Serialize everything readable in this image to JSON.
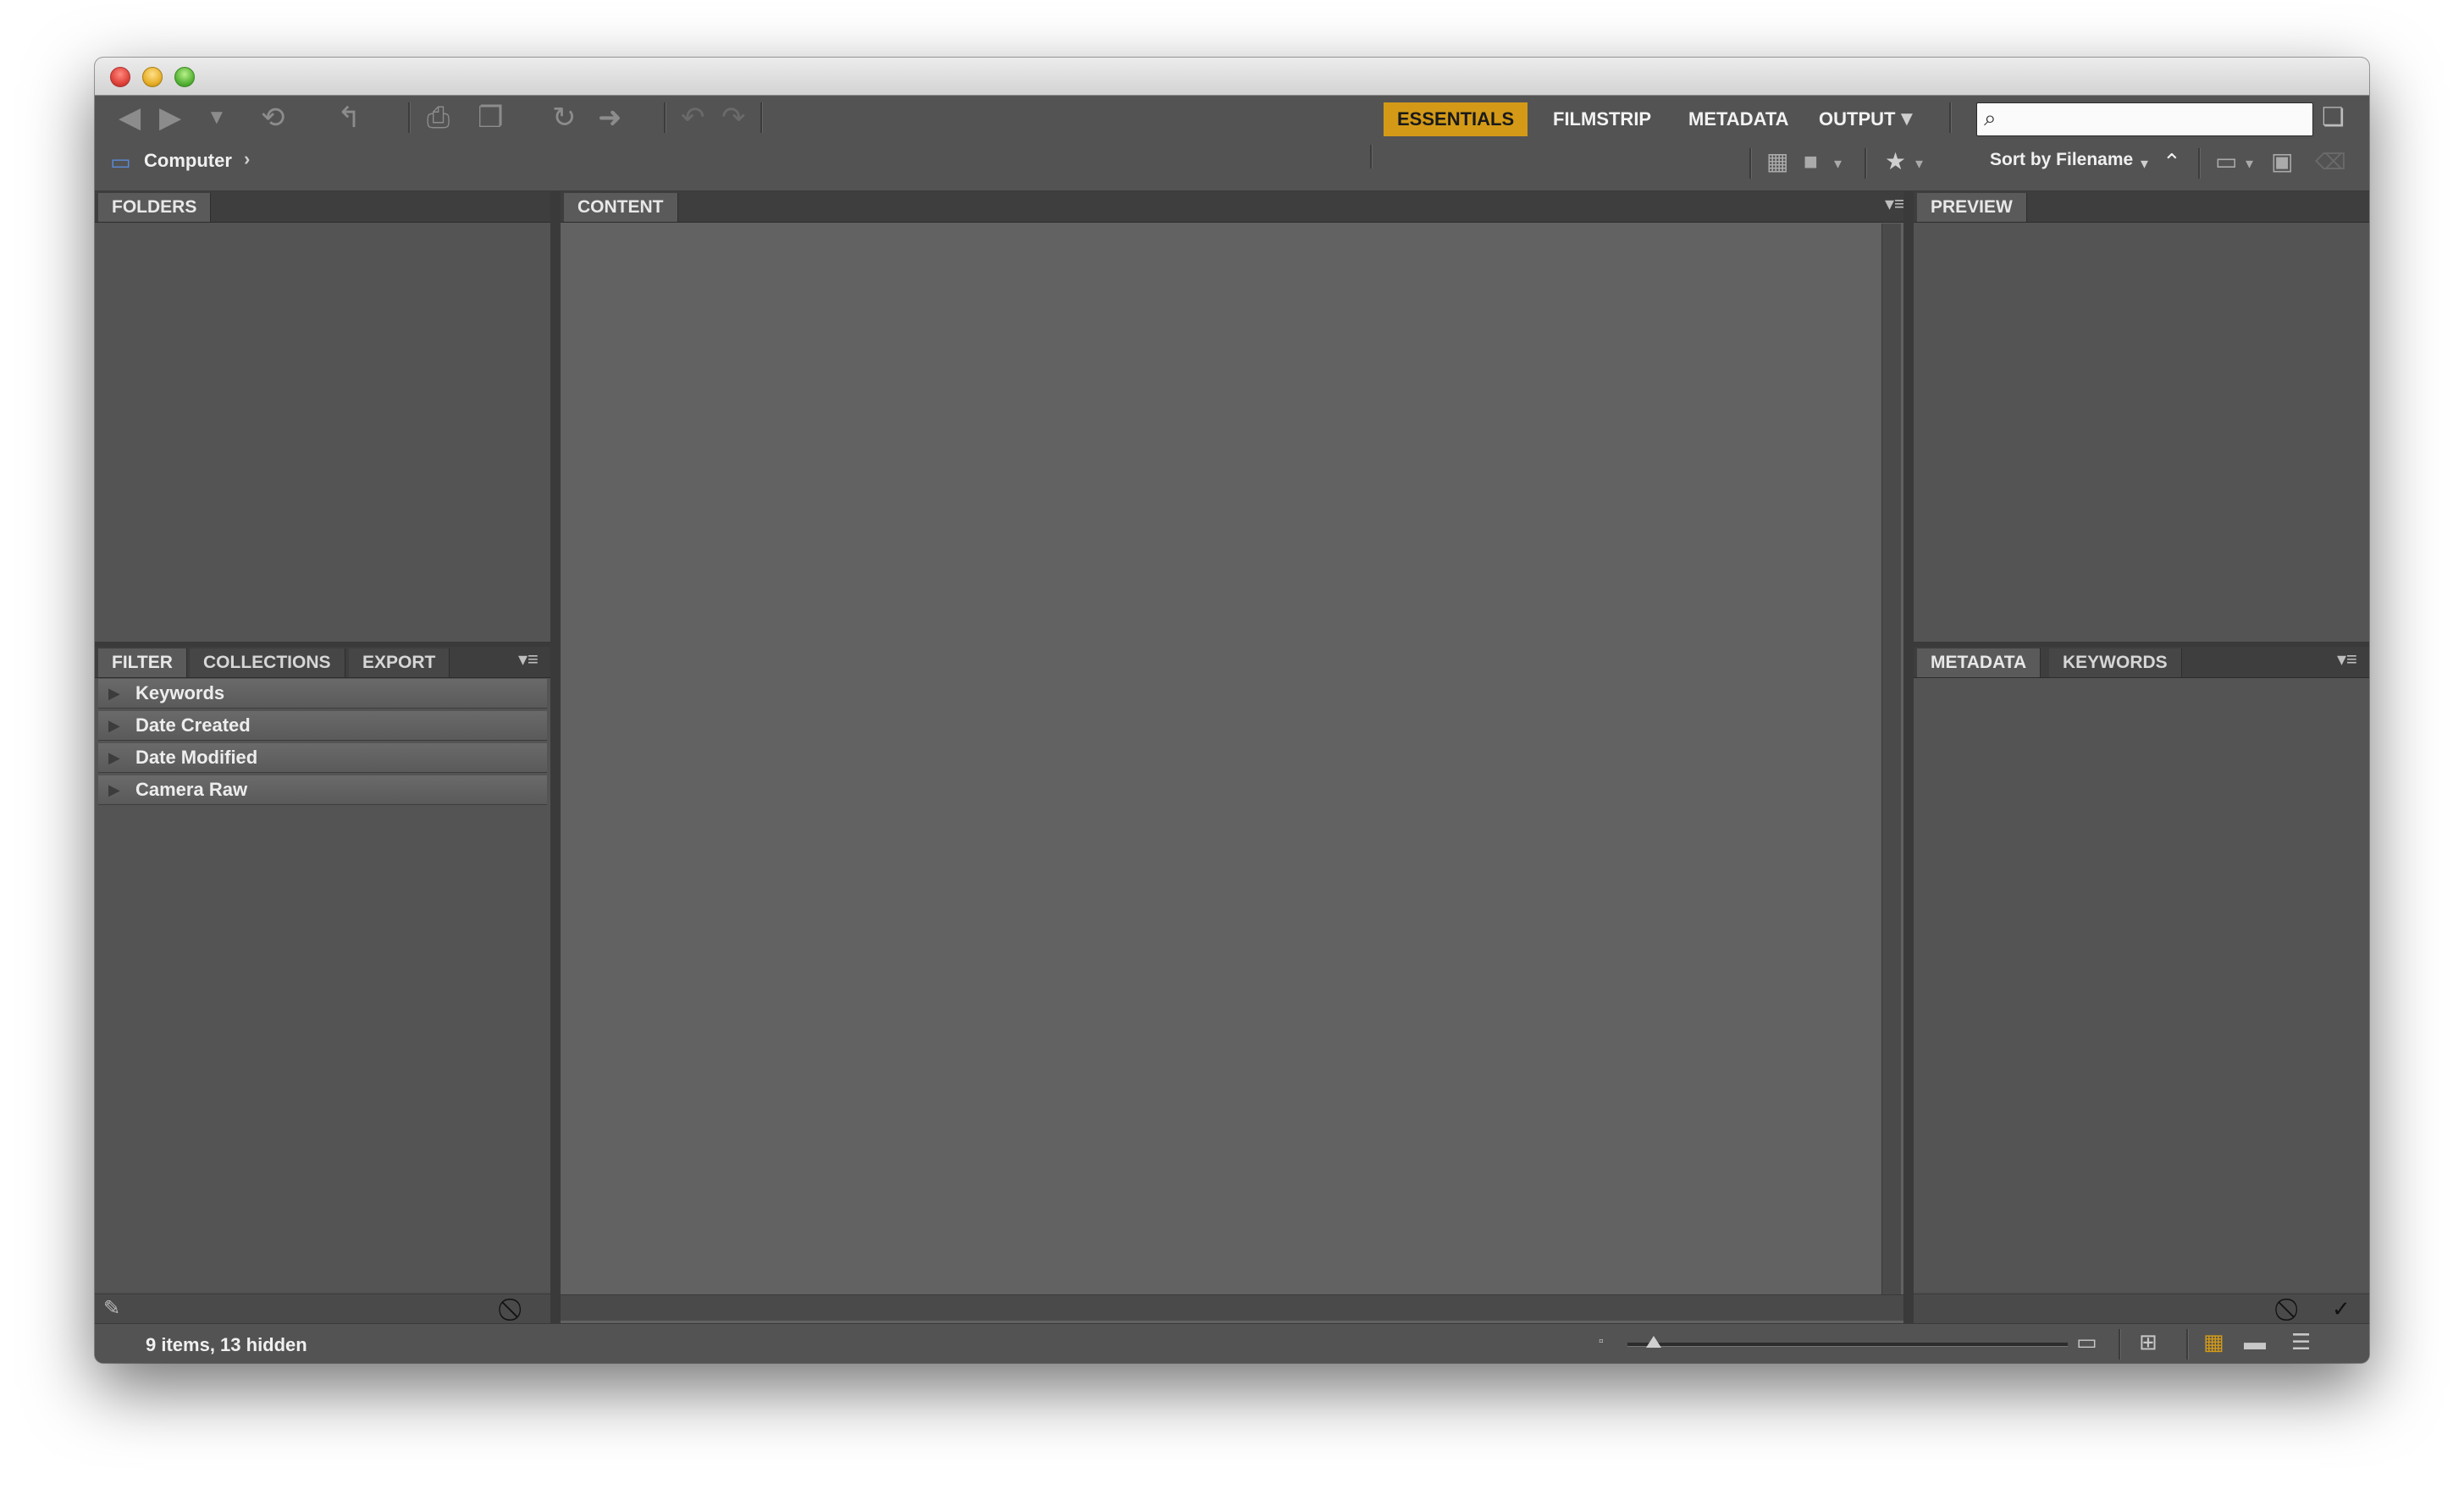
{
  "workspaces": {
    "essentials": "ESSENTIALS",
    "filmstrip": "FILMSTRIP",
    "metadata": "METADATA",
    "output": "OUTPUT"
  },
  "path": {
    "location": "Computer",
    "separator": "›"
  },
  "sort": {
    "label": "Sort by Filename"
  },
  "panels": {
    "folders": "FOLDERS",
    "content": "CONTENT",
    "preview": "PREVIEW",
    "filter": "FILTER",
    "collections": "COLLECTIONS",
    "export": "EXPORT",
    "metadata": "METADATA",
    "keywords": "KEYWORDS"
  },
  "filter_items": [
    "Keywords",
    "Date Created",
    "Date Modified",
    "Camera Raw"
  ],
  "status": {
    "text": "9 items, 13 hidden"
  },
  "thumbnail_size": {
    "fraction": 0.06
  },
  "colors": {
    "accent": "#d49a17",
    "panel": "#545454",
    "content": "#626262"
  },
  "icons": {
    "back": "back-arrow-icon",
    "forward": "forward-arrow-icon",
    "recent": "recent-dropdown-icon",
    "boomerang": "return-icon",
    "camera": "camera-download-icon",
    "refine": "refine-icon",
    "rotate": "rotate-icon",
    "open": "open-file-icon"
  }
}
